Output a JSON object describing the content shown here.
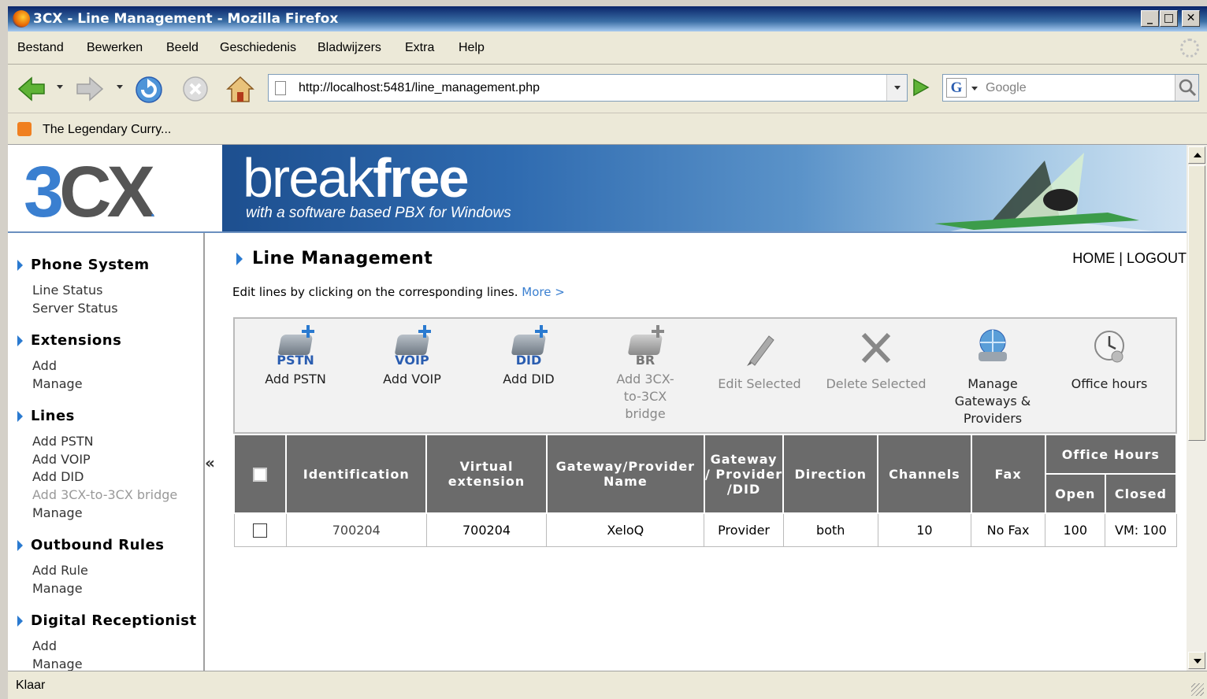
{
  "window": {
    "title": "3CX - Line Management - Mozilla Firefox",
    "controls": {
      "minimize": "_",
      "maximize": "□",
      "close": "✕"
    }
  },
  "menu": [
    "Bestand",
    "Bewerken",
    "Beeld",
    "Geschiedenis",
    "Bladwijzers",
    "Extra",
    "Help"
  ],
  "navigation": {
    "url": "http://localhost:5481/line_management.php",
    "search_placeholder": "Google",
    "search_engine_letter": "G"
  },
  "bookmarks": [
    "The Legendary Curry..."
  ],
  "status": "Klaar",
  "banner": {
    "logo_3": "3",
    "logo_cx": "CX",
    "logo_dot": ".",
    "slogan_light": "break",
    "slogan_bold": "free",
    "tagline": "with a software based PBX for Windows"
  },
  "sidebar": {
    "sections": [
      {
        "title": "Phone System",
        "items": [
          {
            "label": "Line Status"
          },
          {
            "label": "Server Status"
          }
        ]
      },
      {
        "title": "Extensions",
        "items": [
          {
            "label": "Add"
          },
          {
            "label": "Manage"
          }
        ]
      },
      {
        "title": "Lines",
        "items": [
          {
            "label": "Add PSTN"
          },
          {
            "label": "Add VOIP"
          },
          {
            "label": "Add DID"
          },
          {
            "label": "Add 3CX-to-3CX bridge"
          },
          {
            "label": "Manage"
          }
        ]
      },
      {
        "title": "Outbound Rules",
        "items": [
          {
            "label": "Add Rule"
          },
          {
            "label": "Manage"
          }
        ]
      },
      {
        "title": "Digital Receptionist",
        "items": [
          {
            "label": "Add"
          },
          {
            "label": "Manage"
          }
        ]
      }
    ],
    "collapse_glyph": "«"
  },
  "main": {
    "title": "Line Management",
    "home": "HOME",
    "separator": " | ",
    "logout": "LOGOUT",
    "intro": "Edit lines by clicking on the corresponding lines.",
    "more_link": "More >"
  },
  "toolbar": {
    "add_pstn": {
      "badge": "PSTN",
      "label": "Add PSTN"
    },
    "add_voip": {
      "badge": "VOIP",
      "label": "Add VOIP"
    },
    "add_did": {
      "badge": "DID",
      "label": "Add DID"
    },
    "add_bridge": {
      "badge": "BR",
      "label": "Add 3CX-to-3CX bridge"
    },
    "edit_selected": {
      "label": "Edit Selected"
    },
    "delete_selected": {
      "label": "Delete Selected"
    },
    "manage_gateways": {
      "label": "Manage Gateways & Providers"
    },
    "office_hours": {
      "label": "Office hours"
    }
  },
  "table": {
    "headers": {
      "identification": "Identification",
      "virtual_extension": "Virtual extension",
      "gateway_name": "Gateway/Provider Name",
      "gateway_did": "Gateway / Provider /DID",
      "direction": "Direction",
      "channels": "Channels",
      "fax": "Fax",
      "office_hours": "Office Hours",
      "open": "Open",
      "closed": "Closed"
    },
    "rows": [
      {
        "identification": "700204",
        "virtual_extension": "700204",
        "gateway_name": "XeloQ",
        "type": "Provider",
        "direction": "both",
        "channels": "10",
        "fax": "No Fax",
        "open": "100",
        "closed": "VM: 100"
      }
    ]
  }
}
